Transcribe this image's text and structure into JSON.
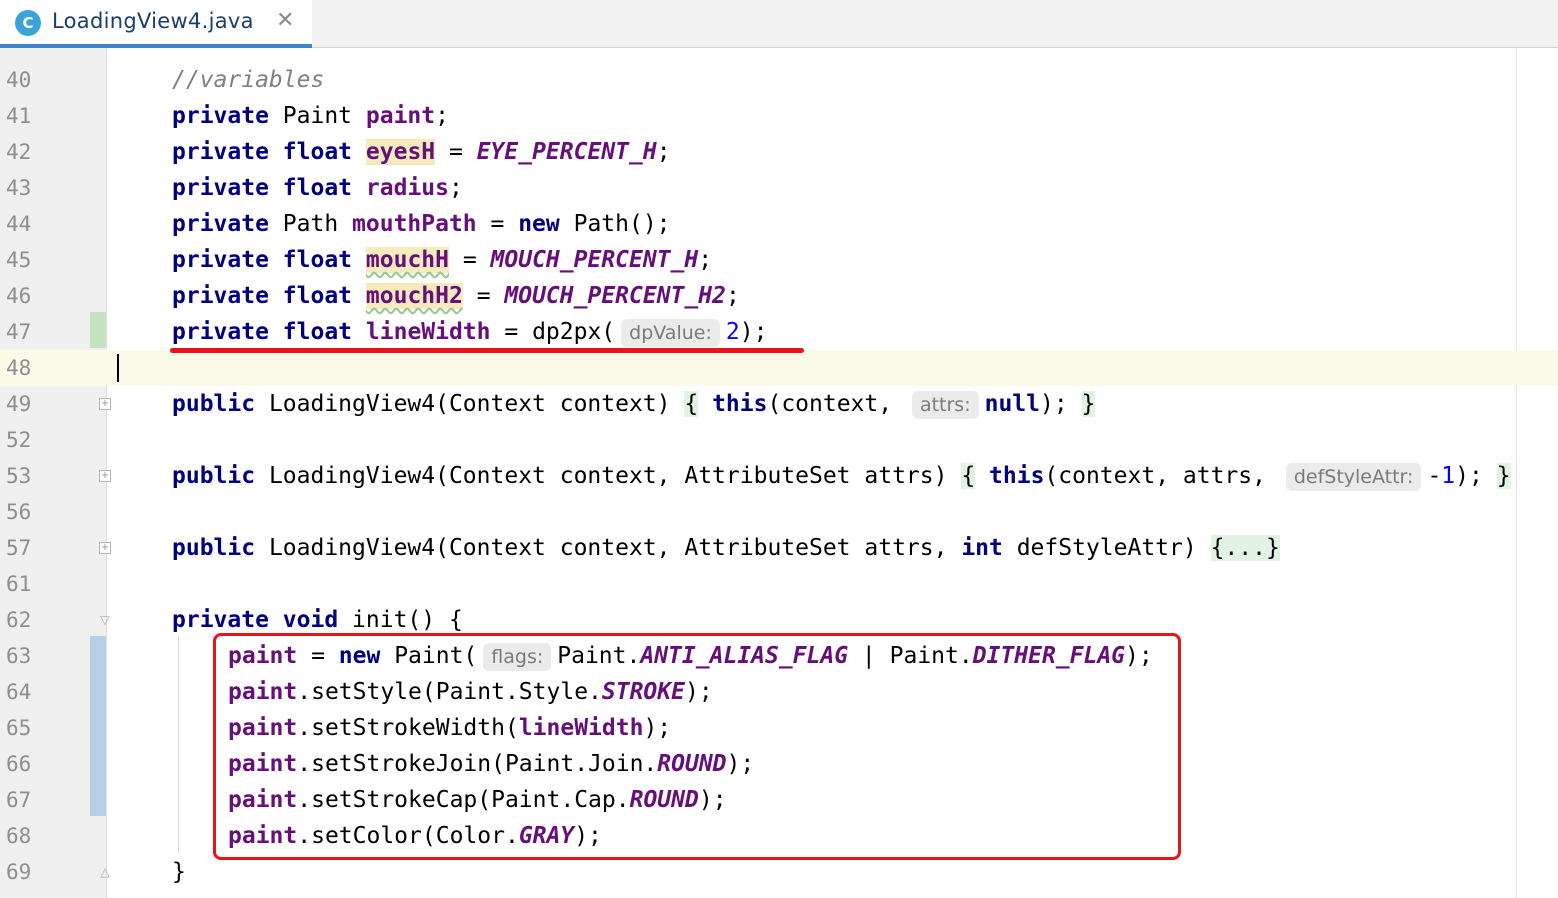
{
  "tab": {
    "icon_letter": "C",
    "filename": "LoadingView4.java",
    "close_glyph": "✕"
  },
  "lines": [
    {
      "n": "40",
      "code": [
        {
          "t": "//variables",
          "c": "cmt"
        }
      ]
    },
    {
      "n": "41",
      "code": [
        {
          "t": "private",
          "c": "kw"
        },
        {
          "t": " Paint "
        },
        {
          "t": "paint",
          "c": "fld"
        },
        {
          "t": ";"
        }
      ]
    },
    {
      "n": "42",
      "code": [
        {
          "t": "private",
          "c": "kw"
        },
        {
          "t": " "
        },
        {
          "t": "float",
          "c": "kw"
        },
        {
          "t": " "
        },
        {
          "t": "eyesH",
          "c": "fld hl"
        },
        {
          "t": " = "
        },
        {
          "t": "EYE_PERCENT_H",
          "c": "const"
        },
        {
          "t": ";"
        }
      ]
    },
    {
      "n": "43",
      "code": [
        {
          "t": "private",
          "c": "kw"
        },
        {
          "t": " "
        },
        {
          "t": "float",
          "c": "kw"
        },
        {
          "t": " "
        },
        {
          "t": "radius",
          "c": "fld"
        },
        {
          "t": ";"
        }
      ]
    },
    {
      "n": "44",
      "code": [
        {
          "t": "private",
          "c": "kw"
        },
        {
          "t": " Path "
        },
        {
          "t": "mouthPath",
          "c": "fld"
        },
        {
          "t": " = "
        },
        {
          "t": "new",
          "c": "kw"
        },
        {
          "t": " Path();"
        }
      ]
    },
    {
      "n": "45",
      "code": [
        {
          "t": "private",
          "c": "kw"
        },
        {
          "t": " "
        },
        {
          "t": "float",
          "c": "kw"
        },
        {
          "t": " "
        },
        {
          "t": "mouchH",
          "c": "fld hl wavy"
        },
        {
          "t": " = "
        },
        {
          "t": "MOUCH_PERCENT_H",
          "c": "const"
        },
        {
          "t": ";"
        }
      ]
    },
    {
      "n": "46",
      "code": [
        {
          "t": "private",
          "c": "kw"
        },
        {
          "t": " "
        },
        {
          "t": "float",
          "c": "kw"
        },
        {
          "t": " "
        },
        {
          "t": "mouchH2",
          "c": "fld hl wavy"
        },
        {
          "t": " = "
        },
        {
          "t": "MOUCH_PERCENT_H2",
          "c": "const"
        },
        {
          "t": ";"
        }
      ]
    },
    {
      "n": "47",
      "code": [
        {
          "t": "private",
          "c": "kw"
        },
        {
          "t": " "
        },
        {
          "t": "float",
          "c": "kw"
        },
        {
          "t": " "
        },
        {
          "t": "lineWidth",
          "c": "fld"
        },
        {
          "t": " = dp2px("
        },
        {
          "t": "dpValue:",
          "c": "hint"
        },
        {
          "t": "2",
          "c": "num"
        },
        {
          "t": ");"
        }
      ]
    },
    {
      "n": "48",
      "code": []
    },
    {
      "n": "49",
      "code": [
        {
          "t": "public",
          "c": "kw"
        },
        {
          "t": " LoadingView4(Context context) "
        },
        {
          "t": "{",
          "c": "brace"
        },
        {
          "t": " "
        },
        {
          "t": "this",
          "c": "kw"
        },
        {
          "t": "(context, "
        },
        {
          "t": "attrs:",
          "c": "hint"
        },
        {
          "t": "null",
          "c": "kw"
        },
        {
          "t": "); "
        },
        {
          "t": "}",
          "c": "brace"
        }
      ]
    },
    {
      "n": "52",
      "code": []
    },
    {
      "n": "53",
      "code": [
        {
          "t": "public",
          "c": "kw"
        },
        {
          "t": " LoadingView4(Context context, AttributeSet attrs) "
        },
        {
          "t": "{",
          "c": "brace"
        },
        {
          "t": " "
        },
        {
          "t": "this",
          "c": "kw"
        },
        {
          "t": "(context, attrs, "
        },
        {
          "t": "defStyleAttr:",
          "c": "hint"
        },
        {
          "t": "-"
        },
        {
          "t": "1",
          "c": "num"
        },
        {
          "t": "); "
        },
        {
          "t": "}",
          "c": "brace"
        }
      ]
    },
    {
      "n": "56",
      "code": []
    },
    {
      "n": "57",
      "code": [
        {
          "t": "public",
          "c": "kw"
        },
        {
          "t": " LoadingView4(Context context, AttributeSet attrs, "
        },
        {
          "t": "int",
          "c": "kw"
        },
        {
          "t": " defStyleAttr) "
        },
        {
          "t": "{...}",
          "c": "brace"
        }
      ]
    },
    {
      "n": "61",
      "code": []
    },
    {
      "n": "62",
      "code": [
        {
          "t": "private",
          "c": "kw"
        },
        {
          "t": " "
        },
        {
          "t": "void",
          "c": "kw"
        },
        {
          "t": " init() {"
        }
      ]
    },
    {
      "n": "63",
      "code": [
        {
          "t": "paint",
          "c": "fld"
        },
        {
          "t": " = "
        },
        {
          "t": "new",
          "c": "kw"
        },
        {
          "t": " Paint("
        },
        {
          "t": "flags:",
          "c": "hint"
        },
        {
          "t": "Paint."
        },
        {
          "t": "ANTI_ALIAS_FLAG",
          "c": "const"
        },
        {
          "t": " | Paint."
        },
        {
          "t": "DITHER_FLAG",
          "c": "const"
        },
        {
          "t": ");"
        }
      ]
    },
    {
      "n": "64",
      "code": [
        {
          "t": "paint",
          "c": "fld"
        },
        {
          "t": ".setStyle(Paint.Style."
        },
        {
          "t": "STROKE",
          "c": "const"
        },
        {
          "t": ");"
        }
      ]
    },
    {
      "n": "65",
      "code": [
        {
          "t": "paint",
          "c": "fld"
        },
        {
          "t": ".setStrokeWidth("
        },
        {
          "t": "lineWidth",
          "c": "fld"
        },
        {
          "t": ");"
        }
      ]
    },
    {
      "n": "66",
      "code": [
        {
          "t": "paint",
          "c": "fld"
        },
        {
          "t": ".setStrokeJoin(Paint.Join."
        },
        {
          "t": "ROUND",
          "c": "const"
        },
        {
          "t": ");"
        }
      ]
    },
    {
      "n": "67",
      "code": [
        {
          "t": "paint",
          "c": "fld"
        },
        {
          "t": ".setStrokeCap(Paint.Cap."
        },
        {
          "t": "ROUND",
          "c": "const"
        },
        {
          "t": ");"
        }
      ]
    },
    {
      "n": "68",
      "code": [
        {
          "t": "paint",
          "c": "fld"
        },
        {
          "t": ".setColor(Color."
        },
        {
          "t": "GRAY",
          "c": "const"
        },
        {
          "t": ");"
        }
      ]
    },
    {
      "n": "69",
      "code": [
        {
          "t": "}"
        }
      ]
    }
  ]
}
